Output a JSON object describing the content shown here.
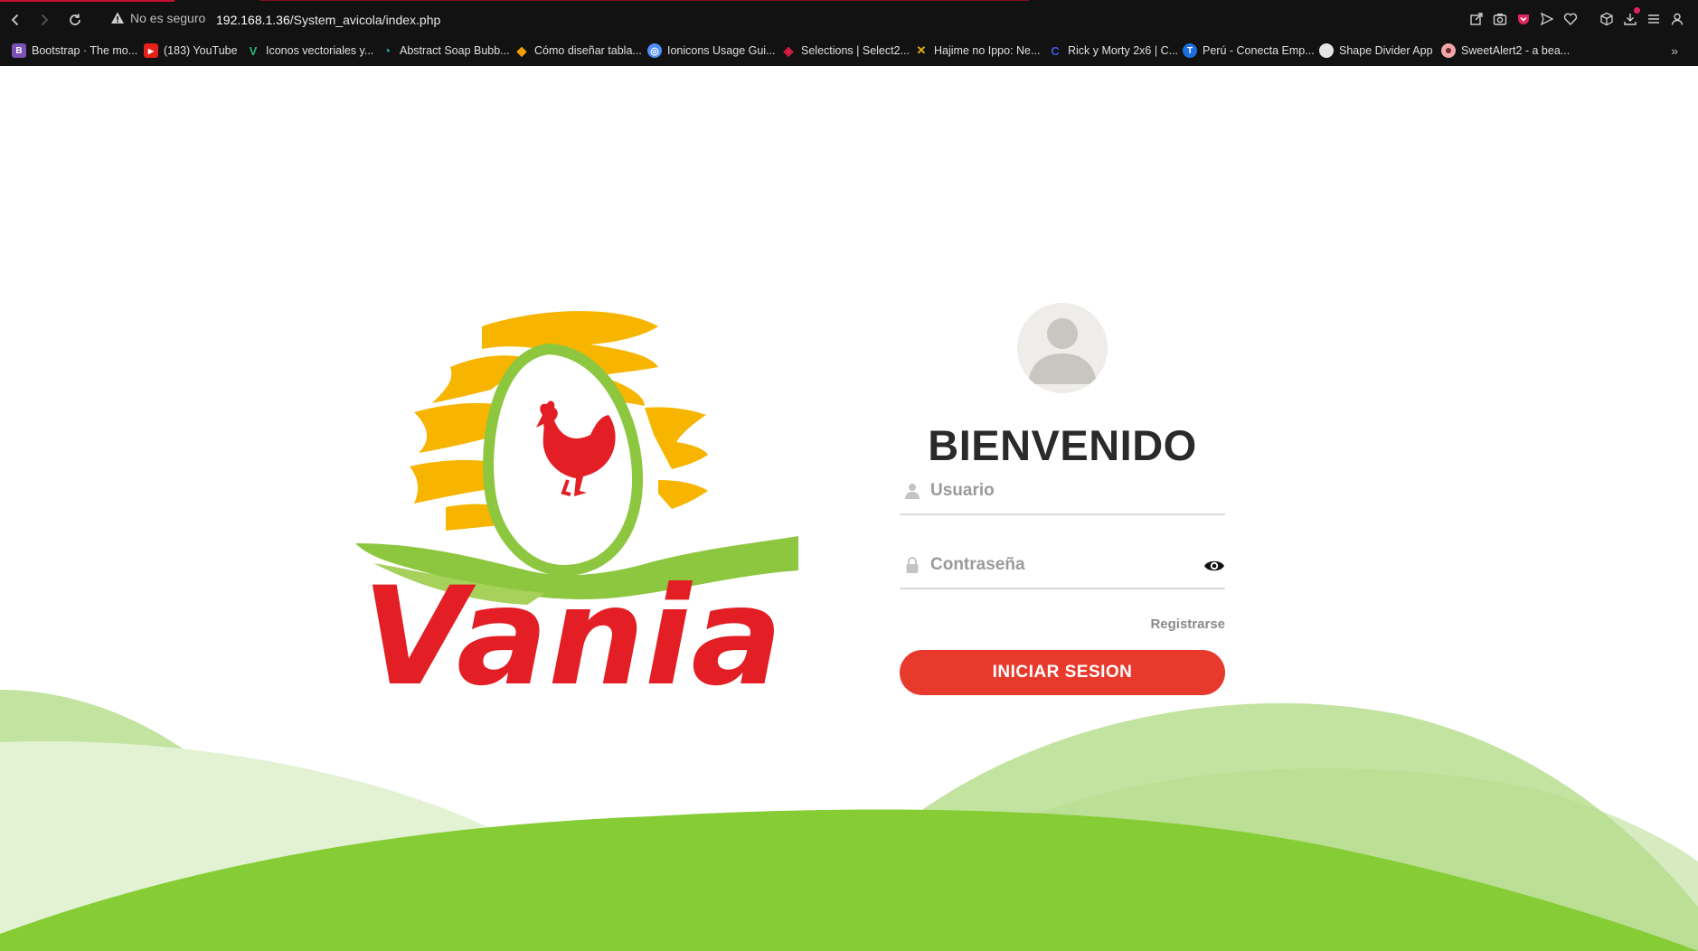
{
  "browser": {
    "security_label": "No es seguro",
    "url_host": "192.168.1.36",
    "url_path": "/System_avicola/index.php",
    "bookmarks": [
      {
        "label": "Bootstrap · The mo...",
        "icon": "B",
        "color": "#7952b3"
      },
      {
        "label": "(183) YouTube",
        "icon": "▶",
        "color": "#e62117"
      },
      {
        "label": "Iconos vectoriales y...",
        "icon": "V",
        "color": "#2bb673"
      },
      {
        "label": "Abstract Soap Bubb...",
        "icon": "◔",
        "color": "#14b8a6"
      },
      {
        "label": "Cómo diseñar tabla...",
        "icon": "◆",
        "color": "#f59e0b"
      },
      {
        "label": "Ionicons Usage Gui...",
        "icon": "◎",
        "color": "#4f8ef7"
      },
      {
        "label": "Selections | Select2...",
        "icon": "◈",
        "color": "#e11d48"
      },
      {
        "label": "Hajime no Ippo: Ne...",
        "icon": "✕",
        "color": "#eab308"
      },
      {
        "label": "Rick y Morty 2x6 | C...",
        "icon": "C",
        "color": "#3b5bdb"
      },
      {
        "label": "Perú - Conecta Emp...",
        "icon": "T",
        "color": "#1d6fe0"
      },
      {
        "label": "Shape Divider App",
        "icon": "◖",
        "color": "#e5e5e5"
      },
      {
        "label": "SweetAlert2 - a bea...",
        "icon": "●",
        "color": "#f1a7a7"
      }
    ]
  },
  "logo": {
    "brand_text": "Vania"
  },
  "login": {
    "title": "BIENVENIDO",
    "username_placeholder": "Usuario",
    "password_placeholder": "Contraseña",
    "register_label": "Registrarse",
    "submit_label": "INICIAR SESION"
  },
  "colors": {
    "primary_button": "#e8392d",
    "wave_dark": "#86cc35",
    "wave_mid": "#c3e3a0",
    "wave_light": "#e3f2d3"
  }
}
